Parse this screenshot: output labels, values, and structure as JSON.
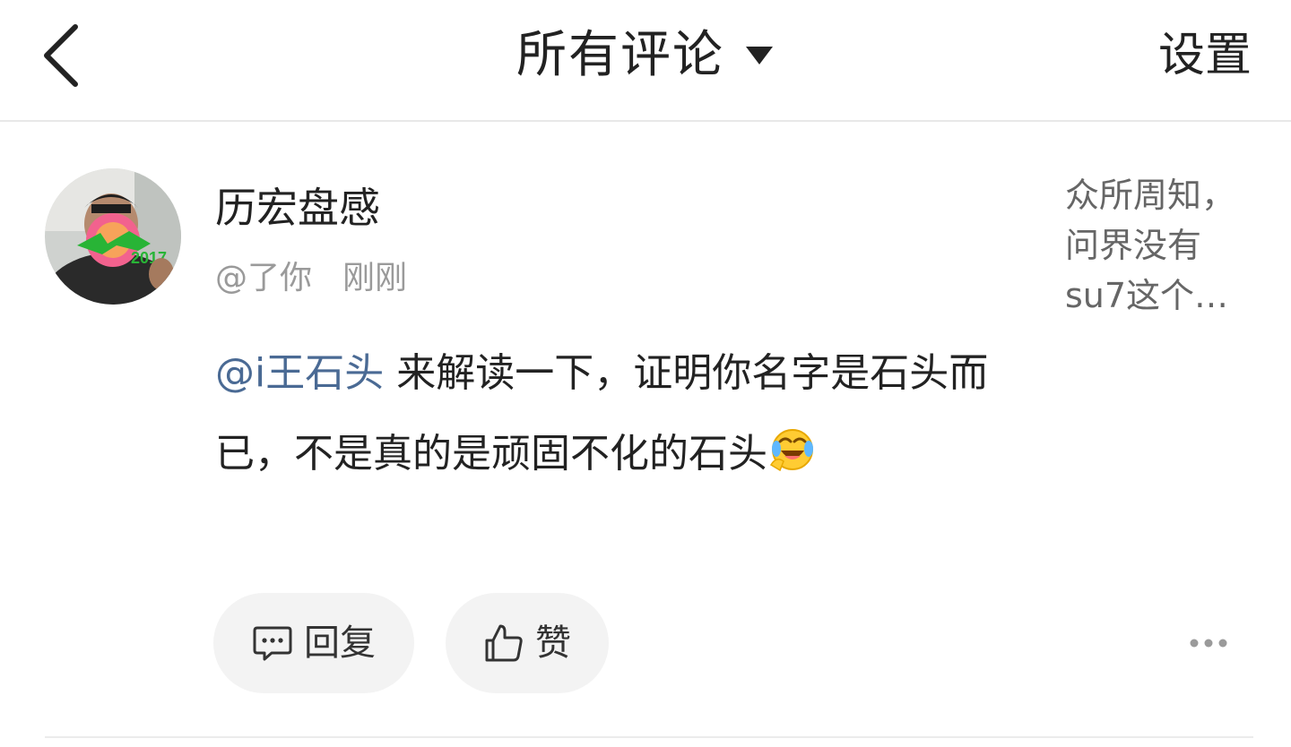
{
  "header": {
    "title": "所有评论",
    "settings_label": "设置",
    "back_icon": "chevron-left-icon",
    "filter_icon": "caret-down-icon"
  },
  "comment": {
    "username": "历宏盘感",
    "reply_to": "@了你",
    "time": "刚刚",
    "mention": "@i王石头",
    "text": " 来解读一下，证明你名字是石头而已，不是真的是顽固不化的石头",
    "emoji": "face-with-tears-of-joy-icon",
    "avatar_badge": "2017",
    "snippet": "众所周知，问界没有su7这个…",
    "actions": {
      "reply_label": "回复",
      "like_label": "赞"
    }
  },
  "colors": {
    "mention": "#4a6a94",
    "secondary_text": "#9a9a9a",
    "pill_bg": "#f3f3f3"
  }
}
